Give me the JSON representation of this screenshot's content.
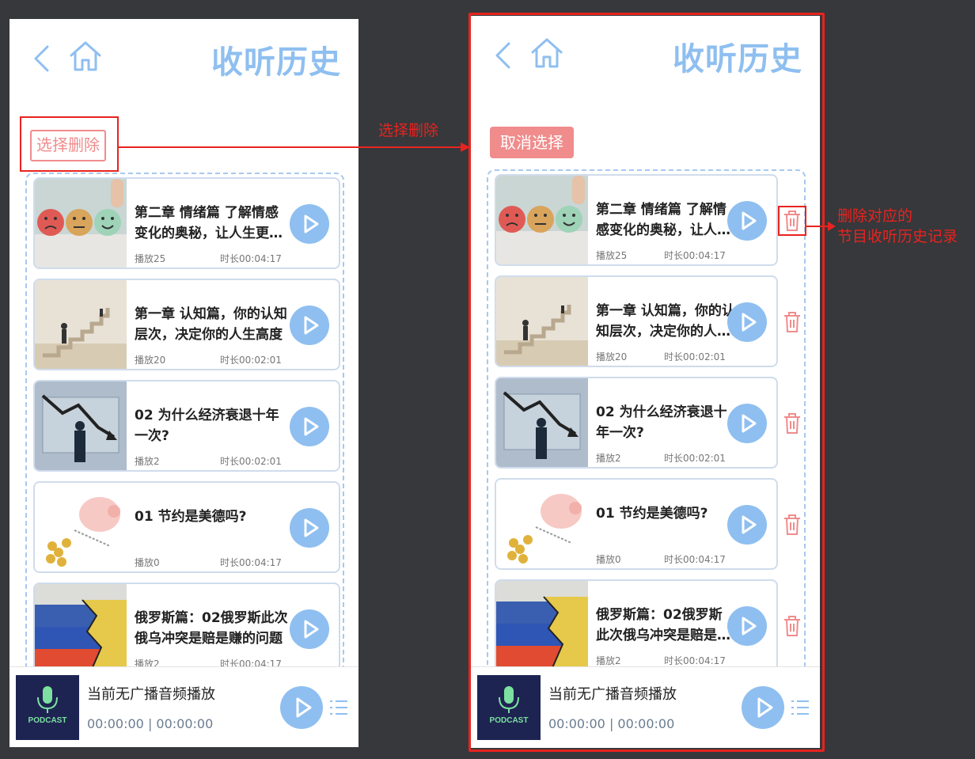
{
  "title": "收听历史",
  "select_delete_label": "选择删除",
  "cancel_select_label": "取消选择",
  "annotations": {
    "arrow_label": "选择删除",
    "delete_note_line1": "删除对应的",
    "delete_note_line2": "节目收听历史记录"
  },
  "episodes": [
    {
      "title": "第二章 情绪篇 了解情感变化的奥秘，让人生更加美好",
      "plays": "播放25",
      "duration": "时长00:04:17",
      "thumb": "emotion-faces"
    },
    {
      "title": "第一章 认知篇，你的认知层次，决定你的人生高度",
      "plays": "播放20",
      "duration": "时长00:02:01",
      "thumb": "stairs"
    },
    {
      "title": "02 为什么经济衰退十年一次?",
      "plays": "播放2",
      "duration": "时长00:02:01",
      "thumb": "economy-chart"
    },
    {
      "title": "01 节约是美德吗?",
      "plays": "播放0",
      "duration": "时长00:04:17",
      "thumb": "piggy-bank"
    },
    {
      "title": "俄罗斯篇：02俄罗斯此次俄乌冲突是赔是赚的问题",
      "plays": "播放2",
      "duration": "时长00:04:17",
      "thumb": "flags"
    }
  ],
  "player": {
    "now_playing": "当前无广播音频播放",
    "time": "00:00:00 | 00:00:00",
    "cover_text": "PODCAST"
  },
  "colors": {
    "accent": "#8fbff0",
    "danger": "#f08c8c",
    "annotation_red": "#e8231f",
    "background": "#36383b"
  }
}
